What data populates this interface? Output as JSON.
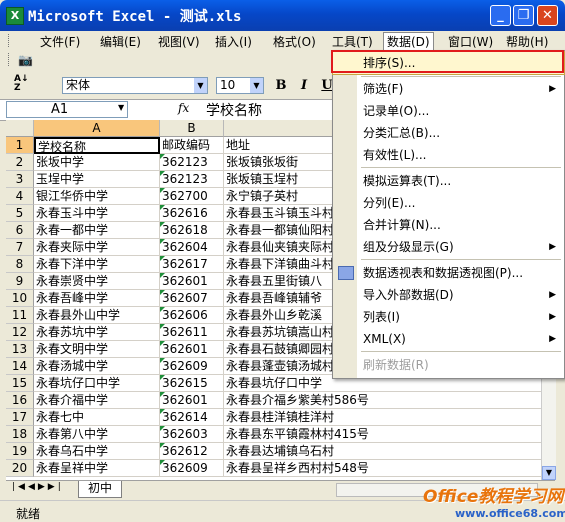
{
  "window": {
    "title": "Microsoft Excel - 测试.xls",
    "minimize": "_",
    "restore": "❐",
    "close": "✕"
  },
  "menu": {
    "items": [
      "文件(F)",
      "编辑(E)",
      "视图(V)",
      "插入(I)",
      "格式(O)",
      "工具(T)",
      "数据(D)",
      "窗口(W)",
      "帮助(H)"
    ],
    "active": "数据(D)"
  },
  "format_bar": {
    "font": "宋体",
    "size": "10",
    "bold": "B",
    "italic": "I",
    "underline": "U"
  },
  "formula_bar": {
    "name_box": "A1",
    "fx": "fx",
    "content": "学校名称"
  },
  "columns": [
    "A",
    "B",
    "C"
  ],
  "rows": [
    {
      "n": "1",
      "a": "学校名称",
      "b": "邮政编码",
      "c": "地址"
    },
    {
      "n": "2",
      "a": "张坂中学",
      "b": "362123",
      "c": "张坂镇张坂街"
    },
    {
      "n": "3",
      "a": "玉埕中学",
      "b": "362123",
      "c": "张坂镇玉埕村"
    },
    {
      "n": "4",
      "a": "银江华侨中学",
      "b": "362700",
      "c": "永宁镇子英村"
    },
    {
      "n": "5",
      "a": "永春玉斗中学",
      "b": "362616",
      "c": "永春县玉斗镇玉斗村"
    },
    {
      "n": "6",
      "a": "永春一都中学",
      "b": "362618",
      "c": "永春县一都镇仙阳村"
    },
    {
      "n": "7",
      "a": "永春夹际中学",
      "b": "362604",
      "c": "永春县仙夹镇夹际村"
    },
    {
      "n": "8",
      "a": "永春下洋中学",
      "b": "362617",
      "c": "永春县下洋镇曲斗村"
    },
    {
      "n": "9",
      "a": "永春崇贤中学",
      "b": "362601",
      "c": "永春县五里街镇八"
    },
    {
      "n": "10",
      "a": "永春吾峰中学",
      "b": "362607",
      "c": "永春县吾峰镇辅爷"
    },
    {
      "n": "11",
      "a": "永春县外山中学",
      "b": "362606",
      "c": "永春县外山乡乾溪"
    },
    {
      "n": "12",
      "a": "永春苏坑中学",
      "b": "362611",
      "c": "永春县苏坑镇嵩山村"
    },
    {
      "n": "13",
      "a": "永春文明中学",
      "b": "362601",
      "c": "永春县石鼓镇卿园村"
    },
    {
      "n": "14",
      "a": "永春汤城中学",
      "b": "362609",
      "c": "永春县蓬壶镇汤城村"
    },
    {
      "n": "15",
      "a": "永春坑仔口中学",
      "b": "362615",
      "c": "永春县坑仔口中学"
    },
    {
      "n": "16",
      "a": "永春介福中学",
      "b": "362601",
      "c": "永春县介福乡紫美村586号"
    },
    {
      "n": "17",
      "a": "永春七中",
      "b": "362614",
      "c": "永春县桂洋镇桂洋村"
    },
    {
      "n": "18",
      "a": "永春第八中学",
      "b": "362603",
      "c": "永春县东平镇霞林村415号"
    },
    {
      "n": "19",
      "a": "永春乌石中学",
      "b": "362612",
      "c": "永春县达埔镇乌石村"
    },
    {
      "n": "20",
      "a": "永春呈祥中学",
      "b": "362609",
      "c": "永春县呈祥乡西村村548号"
    }
  ],
  "sheet_tab": "初中",
  "status": "就绪",
  "data_menu": {
    "items": [
      {
        "label": "排序(S)...",
        "has_sub": false,
        "highlighted": true,
        "disabled": false
      },
      {
        "label": "筛选(F)",
        "has_sub": true,
        "highlighted": false,
        "disabled": false
      },
      {
        "label": "记录单(O)...",
        "has_sub": false,
        "highlighted": false,
        "disabled": false
      },
      {
        "label": "分类汇总(B)...",
        "has_sub": false,
        "highlighted": false,
        "disabled": false
      },
      {
        "label": "有效性(L)...",
        "has_sub": false,
        "highlighted": false,
        "disabled": false
      },
      {
        "label": "模拟运算表(T)...",
        "has_sub": false,
        "highlighted": false,
        "disabled": false
      },
      {
        "label": "分列(E)...",
        "has_sub": false,
        "highlighted": false,
        "disabled": false
      },
      {
        "label": "合并计算(N)...",
        "has_sub": false,
        "highlighted": false,
        "disabled": false
      },
      {
        "label": "组及分级显示(G)",
        "has_sub": true,
        "highlighted": false,
        "disabled": false
      },
      {
        "label": "数据透视表和数据透视图(P)...",
        "has_sub": false,
        "highlighted": false,
        "disabled": false
      },
      {
        "label": "导入外部数据(D)",
        "has_sub": true,
        "highlighted": false,
        "disabled": false
      },
      {
        "label": "列表(I)",
        "has_sub": true,
        "highlighted": false,
        "disabled": false
      },
      {
        "label": "XML(X)",
        "has_sub": true,
        "highlighted": false,
        "disabled": false
      },
      {
        "label": "刷新数据(R)",
        "has_sub": false,
        "highlighted": false,
        "disabled": true
      }
    ]
  },
  "watermark": {
    "brand": "Office教程学习网",
    "url": "www.office68.com"
  },
  "colors": {
    "title_bar": "#0647c8",
    "accent_red": "#e11b1b",
    "selected_header": "#f9c67c",
    "zip_marker": "#1f8f3a"
  }
}
